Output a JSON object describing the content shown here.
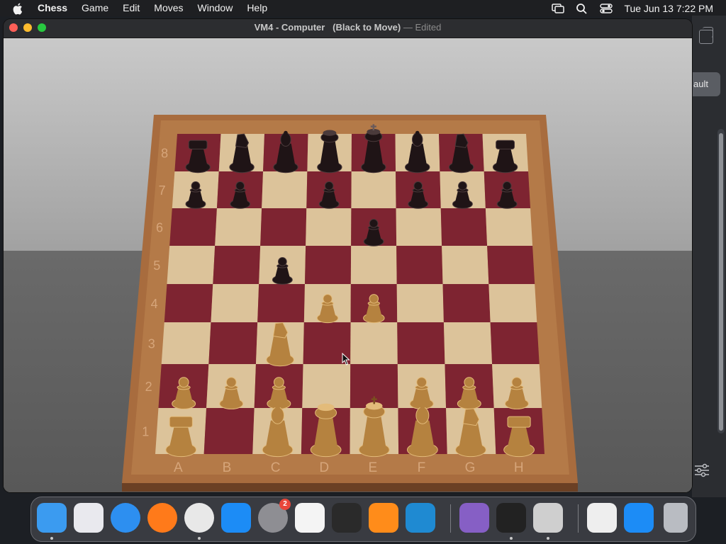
{
  "menubar": {
    "app_name": "Chess",
    "menus": [
      "Game",
      "Edit",
      "Moves",
      "Window",
      "Help"
    ],
    "clock": "Tue Jun 13  7:22 PM"
  },
  "window": {
    "title": "VM4 - Computer",
    "subtitle": "(Black to Move)",
    "separator": "—",
    "edited": "Edited"
  },
  "board": {
    "files": [
      "A",
      "B",
      "C",
      "D",
      "E",
      "F",
      "G",
      "H"
    ],
    "ranks": [
      "1",
      "2",
      "3",
      "4",
      "5",
      "6",
      "7",
      "8"
    ],
    "light_square_color": "#dcc39a",
    "dark_square_color": "#7e2431",
    "frame_color": "#a86c3e",
    "pieces": [
      {
        "square": "a8",
        "piece": "rook",
        "color": "black"
      },
      {
        "square": "b8",
        "piece": "knight",
        "color": "black"
      },
      {
        "square": "c8",
        "piece": "bishop",
        "color": "black"
      },
      {
        "square": "d8",
        "piece": "queen",
        "color": "black"
      },
      {
        "square": "e8",
        "piece": "king",
        "color": "black"
      },
      {
        "square": "f8",
        "piece": "bishop",
        "color": "black"
      },
      {
        "square": "g8",
        "piece": "knight",
        "color": "black"
      },
      {
        "square": "h8",
        "piece": "rook",
        "color": "black"
      },
      {
        "square": "a7",
        "piece": "pawn",
        "color": "black"
      },
      {
        "square": "b7",
        "piece": "pawn",
        "color": "black"
      },
      {
        "square": "d7",
        "piece": "pawn",
        "color": "black"
      },
      {
        "square": "f7",
        "piece": "pawn",
        "color": "black"
      },
      {
        "square": "g7",
        "piece": "pawn",
        "color": "black"
      },
      {
        "square": "h7",
        "piece": "pawn",
        "color": "black"
      },
      {
        "square": "e6",
        "piece": "pawn",
        "color": "black"
      },
      {
        "square": "c5",
        "piece": "pawn",
        "color": "black"
      },
      {
        "square": "d4",
        "piece": "pawn",
        "color": "white"
      },
      {
        "square": "e4",
        "piece": "pawn",
        "color": "white"
      },
      {
        "square": "c3",
        "piece": "knight",
        "color": "white"
      },
      {
        "square": "a2",
        "piece": "pawn",
        "color": "white"
      },
      {
        "square": "b2",
        "piece": "pawn",
        "color": "white"
      },
      {
        "square": "c2",
        "piece": "pawn",
        "color": "white"
      },
      {
        "square": "f2",
        "piece": "pawn",
        "color": "white"
      },
      {
        "square": "g2",
        "piece": "pawn",
        "color": "white"
      },
      {
        "square": "h2",
        "piece": "pawn",
        "color": "white"
      },
      {
        "square": "a1",
        "piece": "rook",
        "color": "white"
      },
      {
        "square": "c1",
        "piece": "bishop",
        "color": "white"
      },
      {
        "square": "d1",
        "piece": "queen",
        "color": "white"
      },
      {
        "square": "e1",
        "piece": "king",
        "color": "white"
      },
      {
        "square": "f1",
        "piece": "bishop",
        "color": "white"
      },
      {
        "square": "g1",
        "piece": "knight",
        "color": "white"
      },
      {
        "square": "h1",
        "piece": "rook",
        "color": "white"
      }
    ]
  },
  "side_panel": {
    "default_label": "ault"
  },
  "dock": {
    "items": [
      {
        "name": "finder-icon",
        "color": "#3b9bf0",
        "running": true
      },
      {
        "name": "launchpad-icon",
        "color": "#e9e9ee",
        "running": false
      },
      {
        "name": "safari-icon",
        "color": "#2d8ff0",
        "running": false
      },
      {
        "name": "firefox-icon",
        "color": "#ff7a1a",
        "running": false
      },
      {
        "name": "chrome-icon",
        "color": "#e8e8e8",
        "running": true
      },
      {
        "name": "app-store-icon",
        "color": "#1c8cf6",
        "running": false
      },
      {
        "name": "system-settings-icon",
        "color": "#8e8e93",
        "running": false,
        "badge": "2"
      },
      {
        "name": "textedit-icon",
        "color": "#f4f4f4",
        "running": false
      },
      {
        "name": "terminal-icon",
        "color": "#2a2a2a",
        "running": false
      },
      {
        "name": "garageband-icon",
        "color": "#ff8c1a",
        "running": false
      },
      {
        "name": "vscode-icon",
        "color": "#1f8ad2",
        "running": false
      },
      {
        "name": "visual-studio-icon",
        "color": "#865fc5",
        "running": false
      },
      {
        "name": "piano-icon",
        "color": "#222222",
        "running": true
      },
      {
        "name": "chess-icon",
        "color": "#cfcfcf",
        "running": true
      },
      {
        "name": "chrome-window-icon",
        "color": "#eeeeee",
        "running": false
      },
      {
        "name": "app-store-downloads-icon",
        "color": "#1c8cf6",
        "running": false
      },
      {
        "name": "trash-icon",
        "color": "#b9bcc2",
        "running": false
      }
    ]
  }
}
